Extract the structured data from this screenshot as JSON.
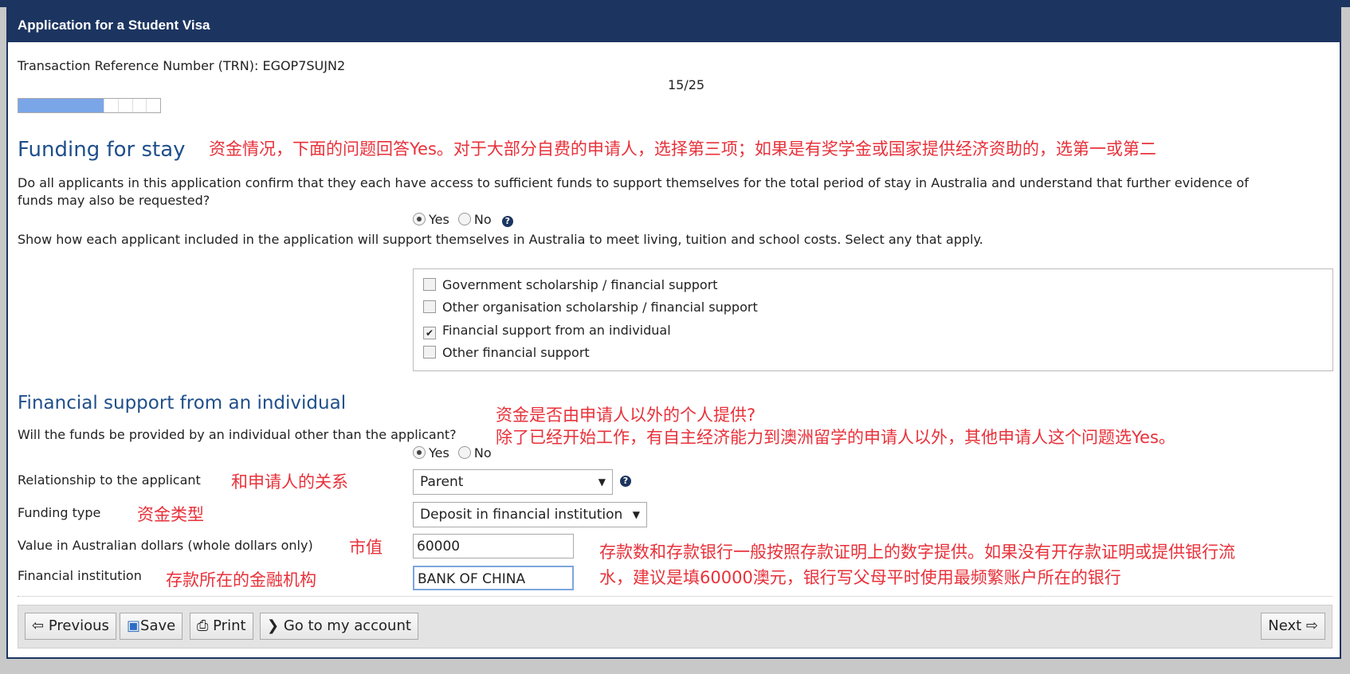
{
  "header": {
    "title": "Application for a Student Visa"
  },
  "trn": "Transaction Reference Number (TRN): EGOP7SUJN2",
  "progress": {
    "label": "15/25",
    "current": 15,
    "total": 25
  },
  "funding": {
    "heading": "Funding for stay",
    "note": "资金情况，下面的问题回答Yes。对于大部分自费的申请人，选择第三项；如果是有奖学金或国家提供经济资助的，选第一或第二",
    "question_line1": "Do all applicants in this application confirm that they each have access to sufficient funds to support themselves for the total period of stay in Australia and understand that further evidence of",
    "question_line2": "funds may also be requested?",
    "yes": "Yes",
    "no": "No",
    "selected": "Yes",
    "instruction": "Show how each applicant included in the application will support themselves in Australia to meet living, tuition and school costs. Select any that apply.",
    "options": [
      {
        "label": "Government scholarship / financial support",
        "checked": false
      },
      {
        "label": "Other organisation scholarship / financial support",
        "checked": false
      },
      {
        "label": "Financial support from an individual",
        "checked": true
      },
      {
        "label": "Other financial support",
        "checked": false
      }
    ]
  },
  "individual": {
    "heading": "Financial support from an individual",
    "note1": "资金是否由申请人以外的个人提供?",
    "note2": "除了已经开始工作，有自主经济能力到澳洲留学的申请人以外，其他申请人这个问题选Yes。",
    "question": "Will the funds be provided by an individual other than the applicant?",
    "yes": "Yes",
    "no": "No",
    "selected": "Yes",
    "relationship_label": "Relationship to the applicant",
    "relationship_note": "和申请人的关系",
    "relationship_value": "Parent",
    "type_label": "Funding type",
    "type_note": "资金类型",
    "type_value": "Deposit in financial institution",
    "value_label": "Value in Australian dollars (whole dollars only)",
    "value_note": "市值",
    "value_value": "60000",
    "institution_label": "Financial institution",
    "institution_note": "存款所在的金融机构",
    "institution_value": "BANK OF CHINA",
    "deposit_note1": "存款数和存款银行一般按照存款证明上的数字提供。如果没有开存款证明或提供银行流",
    "deposit_note2": "水，建议是填60000澳元，银行写父母平时使用最频繁账户所在的银行"
  },
  "buttons": {
    "previous": "Previous",
    "save": "Save",
    "print": "Print",
    "account": "Go to my account",
    "next": "Next"
  }
}
